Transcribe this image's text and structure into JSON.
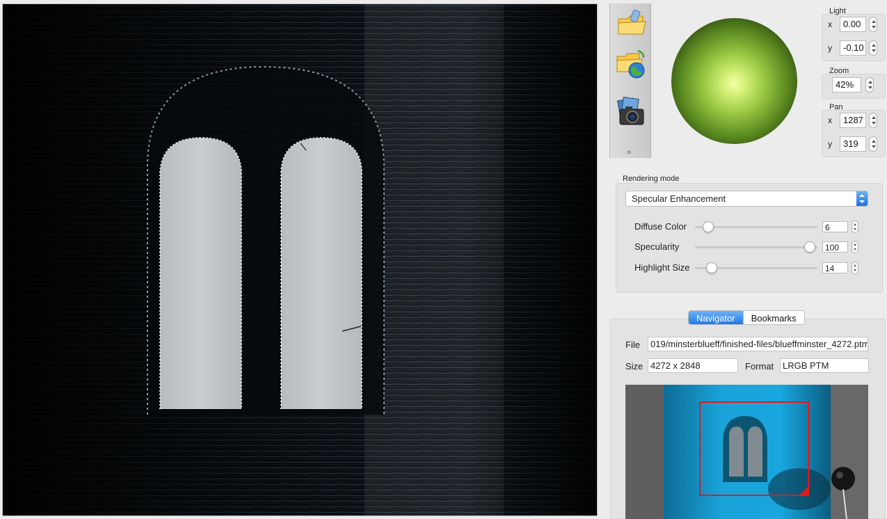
{
  "toolbar": {
    "icons": [
      "open-folder-icon",
      "open-remote-folder-icon",
      "snapshot-camera-icon",
      "more-chevron-icon"
    ],
    "more_glyph": "»"
  },
  "light": {
    "label": "Light",
    "x_label": "x",
    "x_value": "0.00",
    "y_label": "y",
    "y_value": "-0.10"
  },
  "zoom": {
    "label": "Zoom",
    "value": "42%"
  },
  "pan": {
    "label": "Pan",
    "x_label": "x",
    "x_value": "1287",
    "y_label": "y",
    "y_value": "319"
  },
  "rendering": {
    "label": "Rendering mode",
    "selected_mode": "Specular Enhancement",
    "sliders": [
      {
        "label": "Diffuse Color",
        "value": "6",
        "fraction": 0.11
      },
      {
        "label": "Specularity",
        "value": "100",
        "fraction": 0.94
      },
      {
        "label": "Highlight Size",
        "value": "14",
        "fraction": 0.135
      }
    ]
  },
  "navigator": {
    "tabs": [
      "Navigator",
      "Bookmarks"
    ],
    "active_tab": "Navigator",
    "file_label": "File",
    "file_value": "019/minsterblueff/finished-files/blueffminster_4272.ptm",
    "size_label": "Size",
    "size_value": "4272 x 2848",
    "format_label": "Format",
    "format_value": "LRGB PTM"
  },
  "colors": {
    "accent": "#1a72e6",
    "sphere_highlight": "#f4ffa6",
    "viewport_rect": "#e01b1b",
    "thumbnail_blue": "#1aa3d9"
  }
}
